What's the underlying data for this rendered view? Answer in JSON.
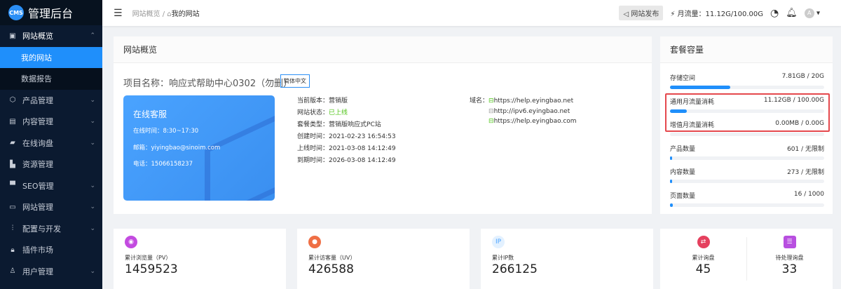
{
  "app": {
    "logo_badge": "CMS",
    "title": "管理后台"
  },
  "sidebar": {
    "overview": {
      "label": "网站概览",
      "subs": [
        "我的网站",
        "数据报告"
      ]
    },
    "items": [
      {
        "label": "产品管理",
        "icon": "cube-icon",
        "chev": true
      },
      {
        "label": "内容管理",
        "icon": "document-icon",
        "chev": true
      },
      {
        "label": "在线询盘",
        "icon": "chat-icon",
        "chev": true
      },
      {
        "label": "资源管理",
        "icon": "folder-icon",
        "chev": false
      },
      {
        "label": "SEO管理",
        "icon": "monitor-icon",
        "chev": true
      },
      {
        "label": "网站管理",
        "icon": "browser-icon",
        "chev": true
      },
      {
        "label": "配置与开发",
        "icon": "sliders-icon",
        "chev": true
      },
      {
        "label": "插件市场",
        "icon": "lock-icon",
        "chev": false
      },
      {
        "label": "用户管理",
        "icon": "user-icon",
        "chev": true
      }
    ]
  },
  "header": {
    "breadcrumb": [
      "网站概览",
      "我的网站"
    ],
    "publish": "网站发布",
    "traffic": "月流量：11.12G/100.00G",
    "avatar": "A"
  },
  "overview": {
    "title": "网站概览",
    "project": "项目名称：响应式帮助中心0302（勿删）",
    "lang": "简体中文",
    "service": {
      "title": "在线客服",
      "hours": "在线时间：8:30~17:30",
      "email": "邮箱：yiyingbao@sinoim.com",
      "phone": "电话：15066158237"
    },
    "info": [
      {
        "k": "当前版本：",
        "v": "营销版"
      },
      {
        "k": "网站状态：",
        "v": "已上线",
        "status": true
      },
      {
        "k": "套餐类型：",
        "v": "营销版响应式PC站"
      },
      {
        "k": "创建时间：",
        "v": "2021-02-23 16:54:53"
      },
      {
        "k": "上线时间：",
        "v": "2021-03-08 14:12:49"
      },
      {
        "k": "到期时间：",
        "v": "2026-03-08 14:12:49"
      }
    ],
    "domain_label": "域名：",
    "domains": [
      {
        "url": "https://help.eyingbao.net",
        "secure": true
      },
      {
        "url": "http://ipv6.eyingbao.net",
        "secure": false
      },
      {
        "url": "https://help.eyingbao.com",
        "secure": true
      }
    ]
  },
  "quota": {
    "title": "套餐容量",
    "items": [
      {
        "label": "存储空间",
        "value": "7.81GB / 20G",
        "pct": 39
      },
      {
        "label": "通用月流量消耗",
        "value": "11.12GB / 100.00G",
        "pct": 11
      },
      {
        "label": "增值月流量消耗",
        "value": "0.00MB / 0.00G",
        "pct": 0
      },
      {
        "label": "产品数量",
        "value": "601 / 无限制",
        "pct": 1
      },
      {
        "label": "内容数量",
        "value": "273 / 无限制",
        "pct": 1
      },
      {
        "label": "页面数量",
        "value": "16 / 1000",
        "pct": 1.6
      }
    ]
  },
  "stats": [
    {
      "label": "累计浏览量（PV）",
      "value": "1459523",
      "color": "#c34be0",
      "icon": "eye-icon",
      "glyph": "◉"
    },
    {
      "label": "累计访客量（UV）",
      "value": "426588",
      "color": "#ef6f45",
      "icon": "user-icon",
      "glyph": "●"
    },
    {
      "label": "累计IP数",
      "value": "266125",
      "color": "#e3f1ff",
      "icon": "ip-icon",
      "glyph": "IP"
    },
    {
      "label": "累计询盘",
      "value": "45",
      "color": "#e5405e",
      "icon": "inquiry-icon",
      "glyph": "⇄"
    },
    {
      "label": "待处理询盘",
      "value": "33",
      "color": "#b84fe0",
      "icon": "pending-icon",
      "glyph": "☰"
    }
  ]
}
